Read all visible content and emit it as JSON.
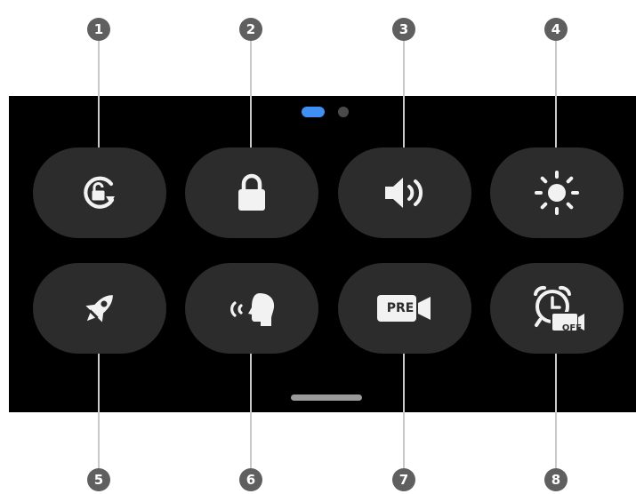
{
  "callouts": [
    "1",
    "2",
    "3",
    "4",
    "5",
    "6",
    "7",
    "8"
  ],
  "page_indicator": {
    "active_color": "#3f8ff5",
    "inactive_color": "#4a4a4a",
    "pages": 2,
    "current": 1
  },
  "tiles": [
    {
      "icon": "auto-rotate-icon",
      "callout": "1"
    },
    {
      "icon": "lock-icon",
      "callout": "2"
    },
    {
      "icon": "volume-icon",
      "callout": "3"
    },
    {
      "icon": "brightness-icon",
      "callout": "4"
    },
    {
      "icon": "rocket-icon",
      "callout": "5"
    },
    {
      "icon": "voice-icon",
      "callout": "6"
    },
    {
      "icon": "pre-record-video-icon",
      "callout": "7",
      "label": "PRE"
    },
    {
      "icon": "alarm-off-icon",
      "callout": "8",
      "label": "OFF"
    }
  ]
}
